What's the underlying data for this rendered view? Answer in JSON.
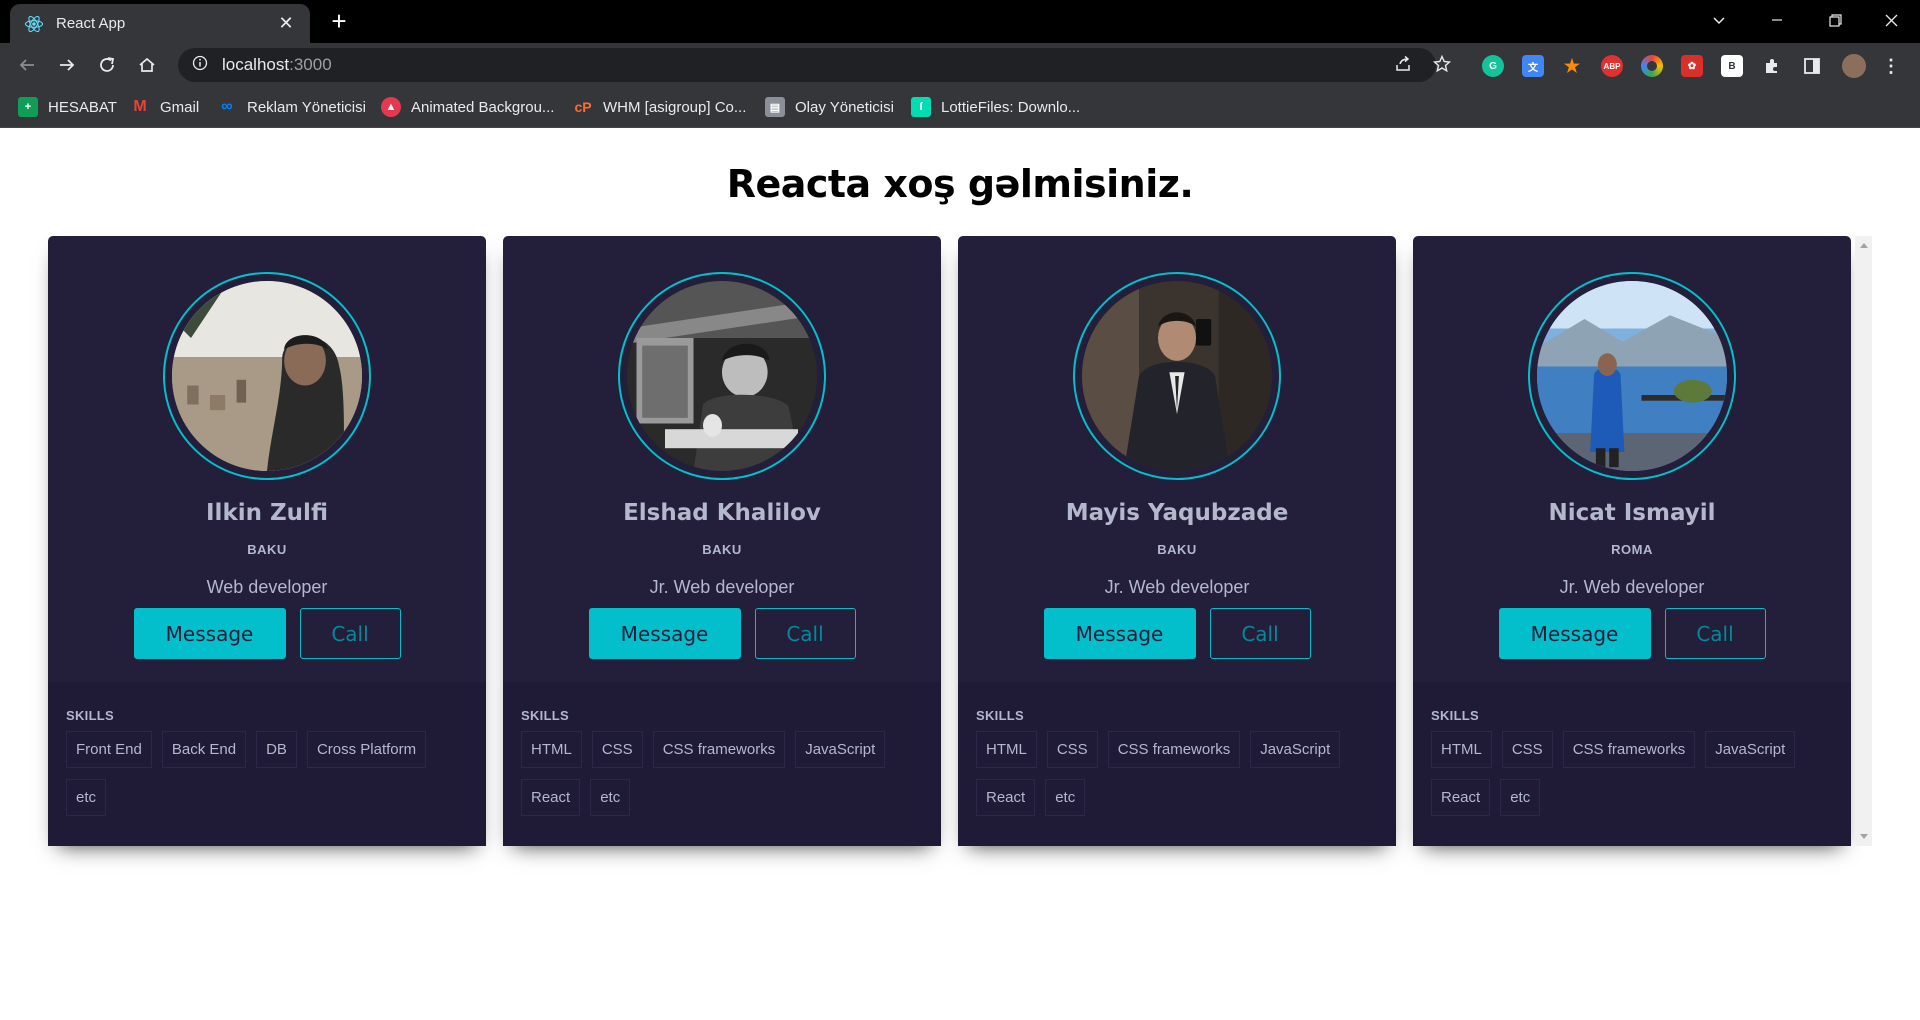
{
  "browser": {
    "tab_title": "React App",
    "url_host": "localhost",
    "url_port": ":3000",
    "bookmarks": [
      {
        "label": "HESABAT",
        "icon": "green-plus-icon",
        "color": "#0f9d58"
      },
      {
        "label": "Gmail",
        "icon": "gmail-icon",
        "color": "#ea4335"
      },
      {
        "label": "Reklam Yöneticisi",
        "icon": "meta-icon",
        "color": "#0081fb"
      },
      {
        "label": "Animated Backgrou...",
        "icon": "red-circle-icon",
        "color": "#e53950"
      },
      {
        "label": "WHM [asigroup] Co...",
        "icon": "cpanel-icon",
        "color": "#ff6c2c"
      },
      {
        "label": "Olay Yöneticisi",
        "icon": "calendar-icon",
        "color": "#8a8f98"
      },
      {
        "label": "LottieFiles: Downlo...",
        "icon": "lottie-icon",
        "color": "#00ddb3"
      }
    ]
  },
  "page": {
    "heading": "Reacta xoş gəlmisiniz.",
    "skills_label": "SKILLS",
    "message_label": "Message",
    "call_label": "Call"
  },
  "colors": {
    "card_bg": "#231e39",
    "skills_bg": "#1f1a36",
    "accent": "#03bfcb",
    "text": "#b3b8cd"
  },
  "cards": [
    {
      "name": "Ilkin Zulfi",
      "city": "BAKU",
      "role": "Web developer",
      "skills": [
        "Front End",
        "Back End",
        "DB",
        "Cross Platform",
        "etc"
      ]
    },
    {
      "name": "Elshad Khalilov",
      "city": "BAKU",
      "role": "Jr. Web developer",
      "skills": [
        "HTML",
        "CSS",
        "CSS frameworks",
        "JavaScript",
        "React",
        "etc"
      ]
    },
    {
      "name": "Mayis Yaqubzade",
      "city": "BAKU",
      "role": "Jr. Web developer",
      "skills": [
        "HTML",
        "CSS",
        "CSS frameworks",
        "JavaScript",
        "React",
        "etc"
      ]
    },
    {
      "name": "Nicat Ismayil",
      "city": "ROMA",
      "role": "Jr. Web developer",
      "skills": [
        "HTML",
        "CSS",
        "CSS frameworks",
        "JavaScript",
        "React",
        "etc"
      ]
    }
  ]
}
